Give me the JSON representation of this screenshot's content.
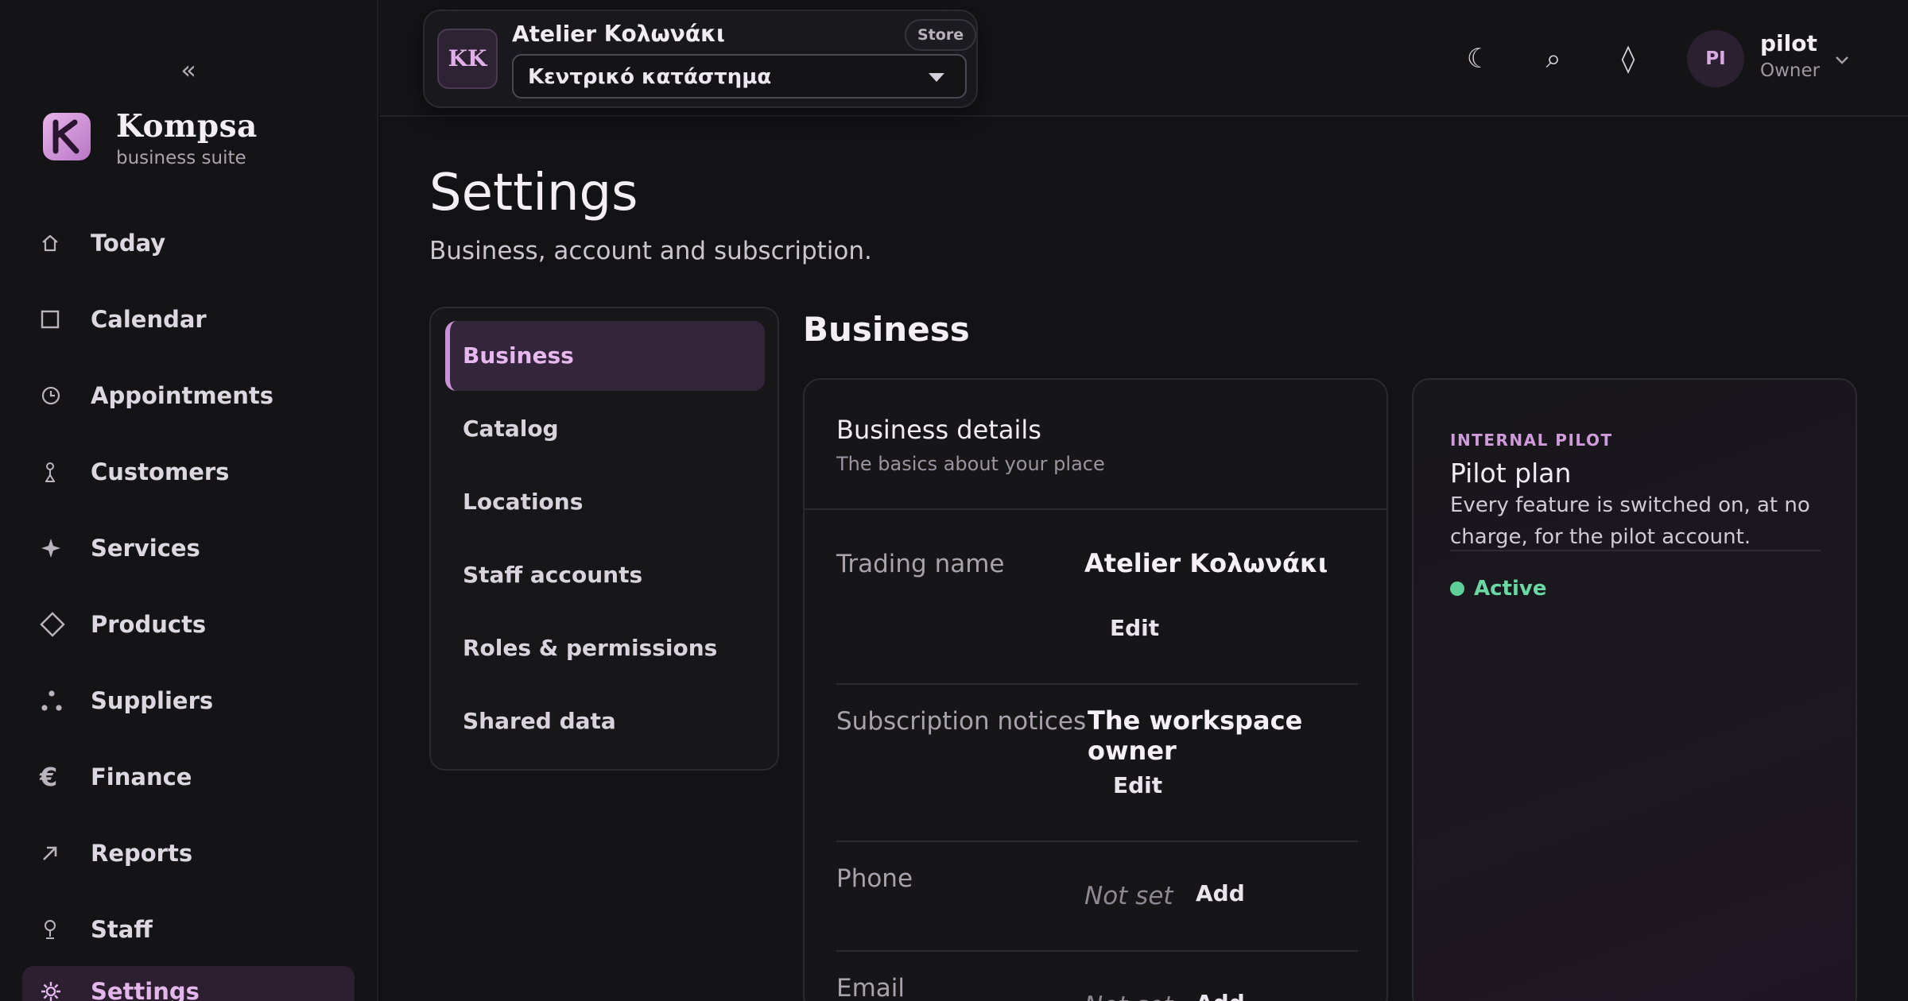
{
  "sidebar": {
    "collapse_glyph": "«",
    "brand": {
      "name": "Kompsa",
      "subtitle": "business suite"
    },
    "items": [
      {
        "label": "Today",
        "icon": "home-icon"
      },
      {
        "label": "Calendar",
        "icon": "calendar-icon"
      },
      {
        "label": "Appointments",
        "icon": "clock-icon"
      },
      {
        "label": "Customers",
        "icon": "person-icon"
      },
      {
        "label": "Services",
        "icon": "sparkle-icon"
      },
      {
        "label": "Products",
        "icon": "diamond-icon"
      },
      {
        "label": "Suppliers",
        "icon": "suppliers-icon"
      },
      {
        "label": "Finance",
        "icon": "euro-icon"
      },
      {
        "label": "Reports",
        "icon": "arrow-up-right-icon"
      },
      {
        "label": "Staff",
        "icon": "staff-icon"
      },
      {
        "label": "Settings",
        "icon": "gear-icon",
        "active": true
      }
    ]
  },
  "topbar": {
    "store": {
      "initials": "KK",
      "name": "Atelier Κολωνάκι",
      "badge": "Store",
      "location": "Κεντρικό κατάστημα"
    },
    "icons": {
      "theme": "☾",
      "search": "⌕",
      "diamond": "◊"
    },
    "user": {
      "initials": "PI",
      "name": "pilot",
      "role": "Owner"
    }
  },
  "page": {
    "title": "Settings",
    "subtitle": "Business, account and subscription."
  },
  "subnav": {
    "items": [
      {
        "label": "Business",
        "active": true
      },
      {
        "label": "Catalog"
      },
      {
        "label": "Locations"
      },
      {
        "label": "Staff accounts"
      },
      {
        "label": "Roles & permissions"
      },
      {
        "label": "Shared data"
      }
    ]
  },
  "section": {
    "title": "Business",
    "details_card": {
      "title": "Business details",
      "subtitle": "The basics about your place",
      "rows": [
        {
          "label": "Trading name",
          "value": "Atelier Κολωνάκι",
          "action": "Edit"
        },
        {
          "label": "Subscription notices",
          "value": "The workspace owner",
          "action": "Edit"
        },
        {
          "label": "Phone",
          "value": "Not set",
          "action": "Add"
        },
        {
          "label": "Email",
          "value": "Not set",
          "action": "Add"
        }
      ]
    },
    "plan_card": {
      "eyebrow": "INTERNAL PILOT",
      "title": "Pilot plan",
      "description": "Every feature is switched on, at no charge, for the pilot account.",
      "status": "Active"
    }
  },
  "colors": {
    "accent": "#e3b6ec",
    "background": "#131315",
    "status_active": "#69d8a3"
  }
}
